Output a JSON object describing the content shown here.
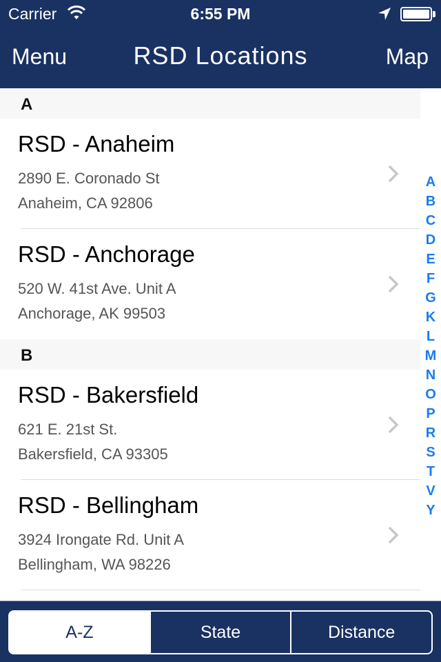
{
  "status_bar": {
    "carrier": "Carrier",
    "time": "6:55 PM",
    "wifi_icon": "wifi-icon",
    "location_icon": "location-arrow-icon",
    "battery_icon": "battery-icon"
  },
  "nav": {
    "left_label": "Menu",
    "title": "RSD Locations",
    "right_label": "Map"
  },
  "sections": [
    {
      "letter": "A",
      "items": [
        {
          "name": "RSD - Anaheim",
          "address1": "2890 E. Coronado St",
          "address2": "Anaheim, CA 92806"
        },
        {
          "name": "RSD - Anchorage",
          "address1": "520 W. 41st Ave. Unit A",
          "address2": "Anchorage, AK 99503"
        }
      ]
    },
    {
      "letter": "B",
      "items": [
        {
          "name": "RSD - Bakersfield",
          "address1": "621 E. 21st St.",
          "address2": "Bakersfield, CA 93305"
        },
        {
          "name": "RSD - Bellingham",
          "address1": "3924 Irongate Rd. Unit A",
          "address2": "Bellingham, WA 98226"
        }
      ]
    }
  ],
  "index_letters": [
    "A",
    "B",
    "C",
    "D",
    "E",
    "F",
    "G",
    "K",
    "L",
    "M",
    "N",
    "O",
    "P",
    "R",
    "S",
    "T",
    "V",
    "Y"
  ],
  "segments": {
    "items": [
      "A-Z",
      "State",
      "Distance"
    ],
    "selected": "A-Z"
  },
  "colors": {
    "brand_navy": "#1a3262",
    "index_blue": "#1a7cf0"
  }
}
